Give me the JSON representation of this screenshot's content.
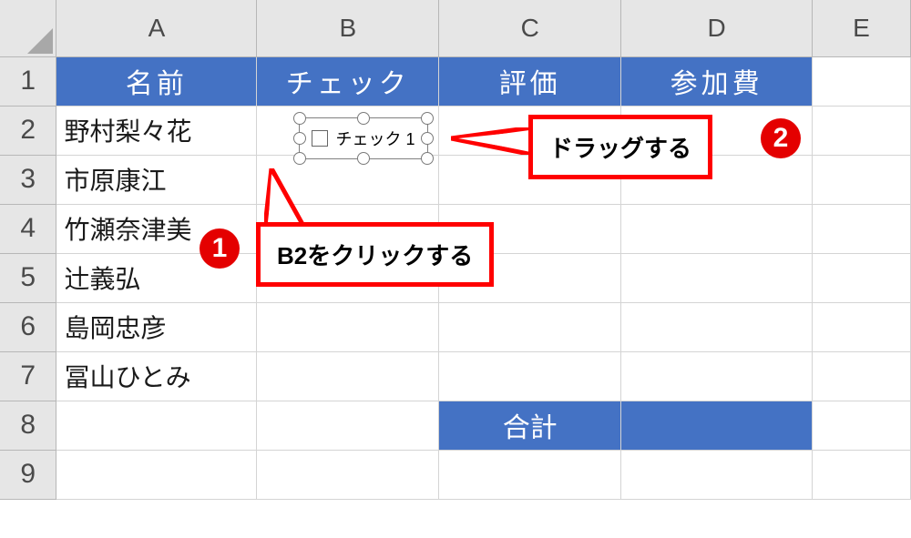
{
  "columns": {
    "A": "A",
    "B": "B",
    "C": "C",
    "D": "D",
    "E": "E"
  },
  "rowNums": {
    "r1": "1",
    "r2": "2",
    "r3": "3",
    "r4": "4",
    "r5": "5",
    "r6": "6",
    "r7": "7",
    "r8": "8",
    "r9": "9"
  },
  "headerRow": {
    "name": "名前",
    "check": "チェック",
    "rating": "評価",
    "fee": "参加費"
  },
  "names": {
    "n1": "野村梨々花",
    "n2": "市原康江",
    "n3": "竹瀬奈津美",
    "n4": "辻義弘",
    "n5": "島岡忠彦",
    "n6": "冨山ひとみ"
  },
  "totalsLabel": "合計",
  "checkboxLabel": "チェック 1",
  "callouts": {
    "c1": "B2をクリックする",
    "c2": "ドラッグする"
  },
  "badges": {
    "b1": "1",
    "b2": "2"
  }
}
